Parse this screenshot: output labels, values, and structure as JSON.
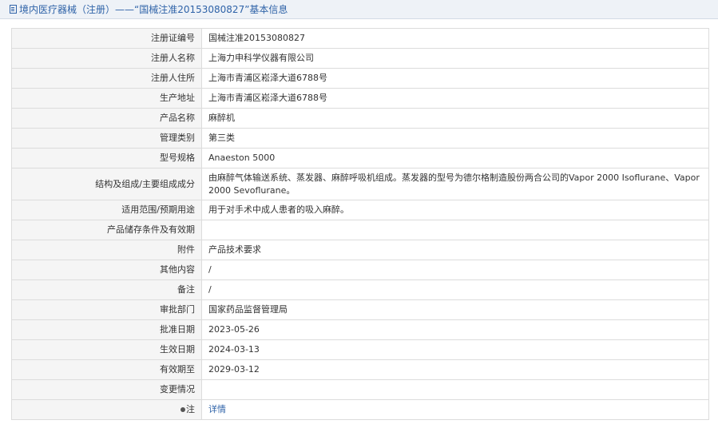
{
  "header": {
    "title": "境内医疗器械（注册）——“国械注准20153080827”基本信息",
    "icon": "document-icon"
  },
  "rows": [
    {
      "label": "注册证编号",
      "value": "国械注准20153080827"
    },
    {
      "label": "注册人名称",
      "value": "上海力申科学仪器有限公司"
    },
    {
      "label": "注册人住所",
      "value": "上海市青浦区崧泽大道6788号"
    },
    {
      "label": "生产地址",
      "value": "上海市青浦区崧泽大道6788号"
    },
    {
      "label": "产品名称",
      "value": "麻醉机"
    },
    {
      "label": "管理类别",
      "value": "第三类"
    },
    {
      "label": "型号规格",
      "value": "Anaeston 5000"
    },
    {
      "label": "结构及组成/主要组成成分",
      "value": "由麻醉气体输送系统、蒸发器、麻醉呼吸机组成。蒸发器的型号为德尔格制造股份两合公司的Vapor 2000 Isoflurane、Vapor 2000 Sevoflurane。"
    },
    {
      "label": "适用范围/预期用途",
      "value": "用于对手术中成人患者的吸入麻醉。"
    },
    {
      "label": "产品储存条件及有效期",
      "value": ""
    },
    {
      "label": "附件",
      "value": "产品技术要求"
    },
    {
      "label": "其他内容",
      "value": "/"
    },
    {
      "label": "备注",
      "value": "/"
    },
    {
      "label": "审批部门",
      "value": "国家药品监督管理局"
    },
    {
      "label": "批准日期",
      "value": "2023-05-26"
    },
    {
      "label": "生效日期",
      "value": "2024-03-13"
    },
    {
      "label": "有效期至",
      "value": "2029-03-12"
    },
    {
      "label": "变更情况",
      "value": ""
    },
    {
      "label": "注",
      "value": "详情",
      "icon": "location-pin-icon"
    }
  ]
}
